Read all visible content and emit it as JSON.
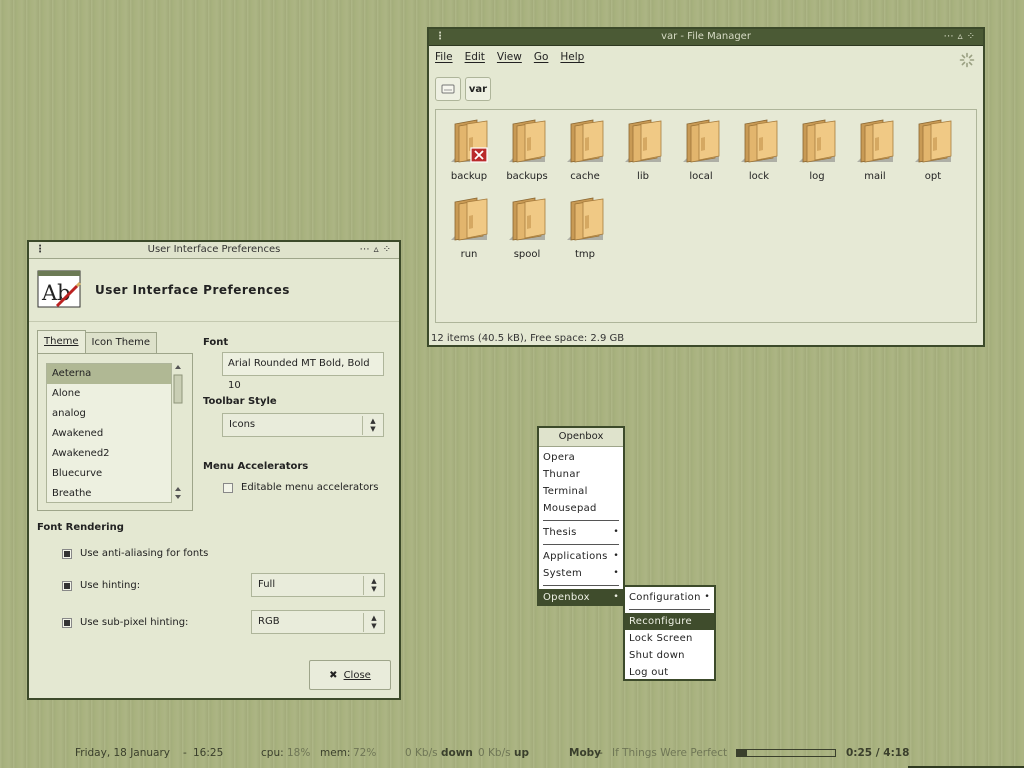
{
  "file_manager": {
    "title": "var - File Manager",
    "menus": [
      "File",
      "Edit",
      "View",
      "Go",
      "Help"
    ],
    "path": [
      "var"
    ],
    "items": [
      {
        "name": "backup",
        "locked": true
      },
      {
        "name": "backups"
      },
      {
        "name": "cache"
      },
      {
        "name": "lib"
      },
      {
        "name": "local"
      },
      {
        "name": "lock"
      },
      {
        "name": "log"
      },
      {
        "name": "mail"
      },
      {
        "name": "opt"
      },
      {
        "name": "run"
      },
      {
        "name": "spool"
      },
      {
        "name": "tmp"
      }
    ],
    "status": "12 items (40.5 kB), Free space: 2.9 GB"
  },
  "prefs": {
    "title": "User Interface Preferences",
    "heading": "User Interface Preferences",
    "tabs": [
      "Theme",
      "Icon Theme"
    ],
    "themes": [
      "Aeterna",
      "Alone",
      "analog",
      "Awakened",
      "Awakened2",
      "Bluecurve",
      "Breathe"
    ],
    "selected_theme": "Aeterna",
    "font_label": "Font",
    "font_value": "Arial Rounded MT Bold, Bold 10",
    "toolbar_label": "Toolbar Style",
    "toolbar_value": "Icons",
    "accel_label": "Menu Accelerators",
    "accel_check": "Editable menu accelerators",
    "accel_checked": false,
    "render_label": "Font Rendering",
    "antialias": "Use anti-aliasing for fonts",
    "hinting": "Use hinting:",
    "hinting_value": "Full",
    "subpixel": "Use sub-pixel hinting:",
    "subpixel_value": "RGB",
    "close": "Close"
  },
  "openbox_menu": {
    "title": "Openbox",
    "group1": [
      "Opera",
      "Thunar",
      "Terminal",
      "Mousepad"
    ],
    "thesis": "Thesis",
    "applications": "Applications",
    "system": "System",
    "openbox": "Openbox"
  },
  "openbox_submenu": {
    "configuration": "Configuration",
    "reconfigure": "Reconfigure",
    "lock": "Lock Screen",
    "shutdown": "Shut down",
    "logout": "Log out"
  },
  "panel": {
    "date": "Friday, 18 January",
    "sep": "-",
    "time": "16:25",
    "cpu_label": "cpu:",
    "cpu": "18%",
    "mem_label": "mem:",
    "mem": "72%",
    "down_rate": "0 Kb/s",
    "down": "down",
    "up_rate": "0 Kb/s",
    "up": "up",
    "artist": "Moby",
    "track": "If Things Were Perfect",
    "progress": 0.1,
    "position": "0:25 / 4:18"
  },
  "colors": {
    "desktop": "#a9b27f",
    "window_border": "#3c4a2a",
    "highlight": "#3f4c2c"
  }
}
